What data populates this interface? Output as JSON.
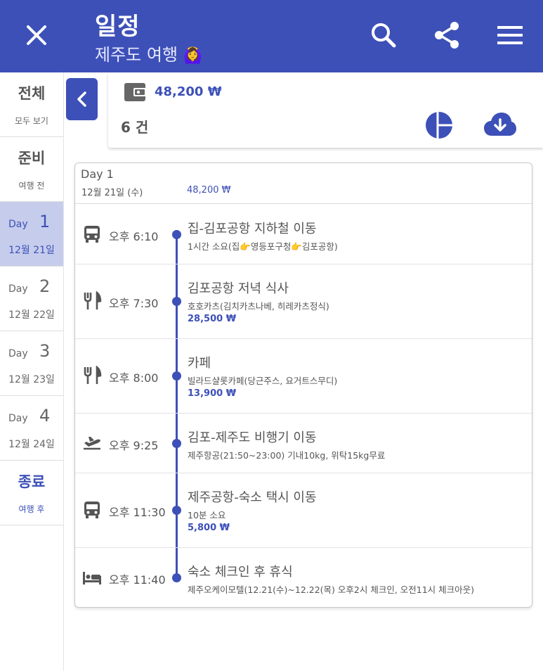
{
  "header": {
    "title": "일정",
    "subtitle": "제주도 여행",
    "subtitle_emoji": "🙆‍♀️",
    "bg_color": "#3d50b8",
    "icons": [
      "close-icon",
      "search-icon",
      "share-icon",
      "menu-icon"
    ]
  },
  "sidebar": {
    "all": {
      "title": "전체",
      "sub": "모두 보기"
    },
    "prep": {
      "title": "준비",
      "sub": "여행 전"
    },
    "days": [
      {
        "label": "Day",
        "num": "1",
        "date": "12월 21일"
      },
      {
        "label": "Day",
        "num": "2",
        "date": "12월 22일"
      },
      {
        "label": "Day",
        "num": "3",
        "date": "12월 23일"
      },
      {
        "label": "Day",
        "num": "4",
        "date": "12월 24일"
      }
    ],
    "end": {
      "title": "종료",
      "sub": "여행 후"
    },
    "active_day": "1"
  },
  "summary": {
    "total": "48,200 ₩",
    "count": "6 건",
    "icons": [
      "wallet-icon",
      "pie-chart-icon",
      "cloud-download-icon"
    ]
  },
  "day": {
    "title": "Day 1",
    "date": "12월 21일 (수)",
    "cost": "48,200 ₩"
  },
  "items": [
    {
      "icon": "bus-icon",
      "time": "오후 6:10",
      "title": "집-김포공항 지하철 이동",
      "desc": "1시간 소요(집👉영등포구청👉김포공항)",
      "cost": ""
    },
    {
      "icon": "restaurant-icon",
      "time": "오후 7:30",
      "title": "김포공항 저녁 식사",
      "desc": "호호카츠(김치카츠나베, 히레카츠정식)",
      "cost": "28,500 ₩"
    },
    {
      "icon": "restaurant-icon",
      "time": "오후 8:00",
      "title": "카페",
      "desc": "빌라드샬롯카페(당근주스, 요거트스무디)",
      "cost": "13,900 ₩"
    },
    {
      "icon": "airplane-takeoff-icon",
      "time": "오후 9:25",
      "title": "김포-제주도 비행기 이동",
      "desc": "제주항공(21:50~23:00) 기내10kg, 위탁15kg무료",
      "cost": ""
    },
    {
      "icon": "bus-icon",
      "time": "오후 11:30",
      "title": "제주공항-숙소 택시 이동",
      "desc": "10분 소요",
      "cost": "5,800 ₩"
    },
    {
      "icon": "hotel-bed-icon",
      "time": "오후 11:40",
      "title": "숙소 체크인 후 휴식",
      "desc": "제주오케이모텔(12.21(수)~12.22(목) 오후2시 체크인, 오전11시 체크아웃)",
      "cost": ""
    }
  ]
}
